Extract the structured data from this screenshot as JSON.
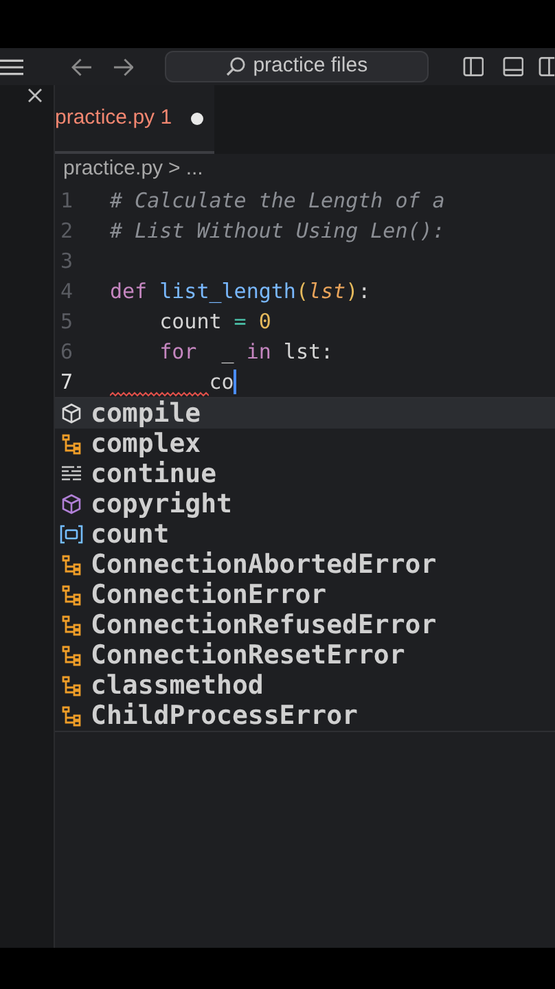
{
  "title_bar": {
    "search": {
      "value": "practice files"
    }
  },
  "tabs": [
    {
      "label": "practice.py 1",
      "selected": true,
      "error": true,
      "modified": true
    }
  ],
  "breadcrumb": {
    "file": "practice.py",
    "separator": ">",
    "rest": "..."
  },
  "code_lines": [
    {
      "number": "1",
      "current": false,
      "error": false,
      "tokens": [
        {
          "t": "# Calculate the Length of a",
          "kind": "comment"
        }
      ]
    },
    {
      "number": "2",
      "current": false,
      "error": false,
      "tokens": [
        {
          "t": "# List Without Using Len():",
          "kind": "comment"
        }
      ]
    },
    {
      "number": "3",
      "current": false,
      "error": false
    },
    {
      "number": "4",
      "current": false,
      "error": false,
      "tokens": [
        {
          "t": "def ",
          "kind": "keyword"
        },
        {
          "t": "list_length",
          "kind": "function"
        },
        {
          "t": "(",
          "kind": "paren"
        },
        {
          "t": "lst",
          "kind": "param"
        },
        {
          "t": ")",
          "kind": "paren"
        },
        {
          "t": ":",
          "kind": "plain"
        }
      ]
    },
    {
      "number": "5",
      "current": false,
      "error": false,
      "tokens": [
        {
          "t": "    count",
          "kind": "plain"
        },
        {
          "t": " = ",
          "kind": "operator"
        },
        {
          "t": "0",
          "kind": "number"
        }
      ]
    },
    {
      "number": "6",
      "current": false,
      "error": false,
      "tokens": [
        {
          "t": "    for",
          "kind": "keyword"
        },
        {
          "t": "  _ ",
          "kind": "plain"
        },
        {
          "t": "in",
          "kind": "keyword"
        },
        {
          "t": " lst:",
          "kind": "plain"
        }
      ]
    },
    {
      "number": "7",
      "current": true,
      "error": true,
      "tokens": [
        {
          "t": "        co",
          "kind": "plain"
        }
      ]
    }
  ],
  "suggestions": [
    {
      "label": "**co**mpile",
      "kind": "method",
      "selected": true
    },
    {
      "label": "**co**mplex",
      "kind": "class",
      "selected": false
    },
    {
      "label": "**co**ntinue",
      "kind": "keyword",
      "selected": false
    },
    {
      "label": "**co**pyright",
      "kind": "module",
      "selected": false
    },
    {
      "label": "**co**unt",
      "kind": "variable",
      "selected": false
    },
    {
      "label": "**Co**nnectionAbortedError",
      "kind": "class",
      "selected": false
    },
    {
      "label": "**Co**nnectionError",
      "kind": "class",
      "selected": false
    },
    {
      "label": "**Co**nnectionRefusedError",
      "kind": "class",
      "selected": false
    },
    {
      "label": "**Co**nnectionResetError",
      "kind": "class",
      "selected": false
    },
    {
      "label": "**c**lassmeth**o**d",
      "kind": "class",
      "selected": false
    },
    {
      "label": "**C**hildPr**o**cessError",
      "kind": "class",
      "selected": false
    }
  ]
}
